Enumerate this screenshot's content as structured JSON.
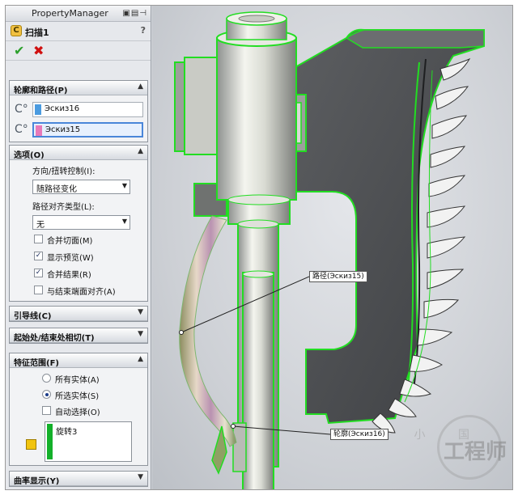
{
  "panel": {
    "title": "PropertyManager",
    "feature_name": "扫描1",
    "help": "?"
  },
  "sections": {
    "profile_path": {
      "label": "轮廓和路径(P)"
    },
    "options": {
      "label": "选项(O)"
    },
    "guide_curves": {
      "label": "引导线(C)"
    },
    "start_end_tangency": {
      "label": "起始处/结束处相切(T)"
    },
    "feature_scope": {
      "label": "特征范围(F)"
    },
    "curvature_display": {
      "label": "曲率显示(Y)"
    }
  },
  "profile": {
    "value": "Эскиз16",
    "color": "#4a9be0"
  },
  "path": {
    "value": "Эскиз15",
    "color": "#e879b9"
  },
  "orientation": {
    "label": "方向/扭转控制(I):",
    "value": "随路径变化"
  },
  "path_alignment": {
    "label": "路径对齐类型(L):",
    "value": "无"
  },
  "checkboxes": [
    {
      "label": "合并切面(M)",
      "checked": false
    },
    {
      "label": "显示预览(W)",
      "checked": true
    },
    {
      "label": "合并结果(R)",
      "checked": true
    },
    {
      "label": "与结束端面对齐(A)",
      "checked": false
    }
  ],
  "scope": {
    "all_bodies": "所有实体(A)",
    "selected_bodies": "所选实体(S)",
    "auto_select": "自动选择(O)",
    "selected_body": "旋转3"
  },
  "callouts": {
    "path": "路径(Эскиз15)",
    "profile": "轮廓(Эскиз16)"
  },
  "watermark": {
    "small": "小 国",
    "big": "工程师"
  },
  "colors": {
    "edge_highlight": "#22dd22",
    "blade_dark": "#4d4f52"
  }
}
